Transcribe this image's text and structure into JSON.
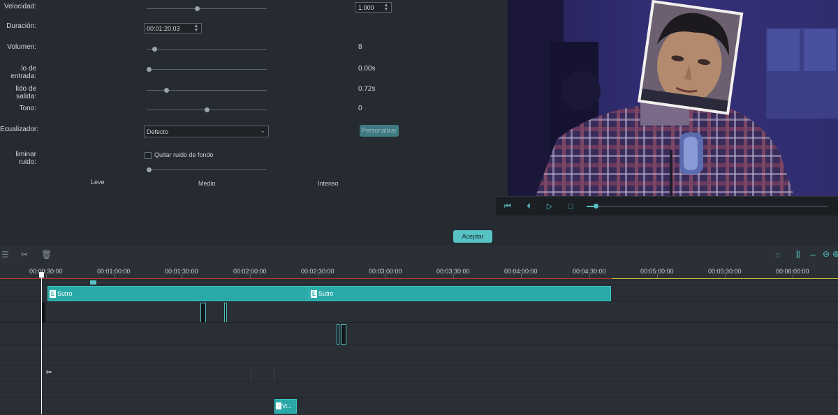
{
  "settings": {
    "speed_label": "Velocidad:",
    "speed_value": "1.000",
    "speed_level": 0.42,
    "duration_label": "Duración:",
    "duration_value": "00:01:20.03",
    "volume_label": "Volumen:",
    "volume_value": "8",
    "volume_level": 0.05,
    "fade_in_label": "lo de entrada:",
    "fade_in_value": "0.00s",
    "fade_in_level": 0.0,
    "fade_out_label": "lido de salida:",
    "fade_out_value": "0.72s",
    "fade_out_level": 0.15,
    "pitch_label": "Tono:",
    "pitch_value": "0",
    "pitch_level": 0.5,
    "equalizer_label": "Ecualizador:",
    "equalizer_value": "Defecto",
    "customize_button": "Personalizar",
    "denoise_label": "liminar ruido:",
    "denoise_checkbox_label": "Quitar ruido de fondo",
    "denoise_level": 0.0,
    "level_low": "Leve",
    "level_mid": "Medio",
    "level_high": "Intenso",
    "accept_button": "Aceptar"
  },
  "player": {
    "progress": 0.03
  },
  "ruler": {
    "ticks": [
      "00:00:30:00",
      "00:01:00:00",
      "00:01:30:00",
      "00:02:00:00",
      "00:02:30:00",
      "00:03:00:00",
      "00:03:30:00",
      "00:04:00:00",
      "00:04:30:00",
      "00:05:00:00",
      "00:05:30:00",
      "00:06:00:00"
    ]
  },
  "timeline": {
    "title_clip_1": "Sutro",
    "title_clip_2": "Sutro",
    "audio_clip": "Vi..."
  },
  "colors": {
    "accent": "#56c2c4",
    "clip": "#2aa9a8",
    "panel": "#262b31",
    "playhead": "#ffffff",
    "ruler_red": "#c0392b",
    "ruler_yellow": "#d4c23a"
  },
  "icons": [
    "cut-icon",
    "delete-icon",
    "settings-icon",
    "render-icon",
    "audio-mixer-icon",
    "fit-icon",
    "zoom-out-icon",
    "zoom-in-icon",
    "first-frame-icon",
    "prev-frame-icon",
    "play-icon",
    "stop-icon",
    "scissors-icon",
    "music-note-icon",
    "title-icon"
  ]
}
